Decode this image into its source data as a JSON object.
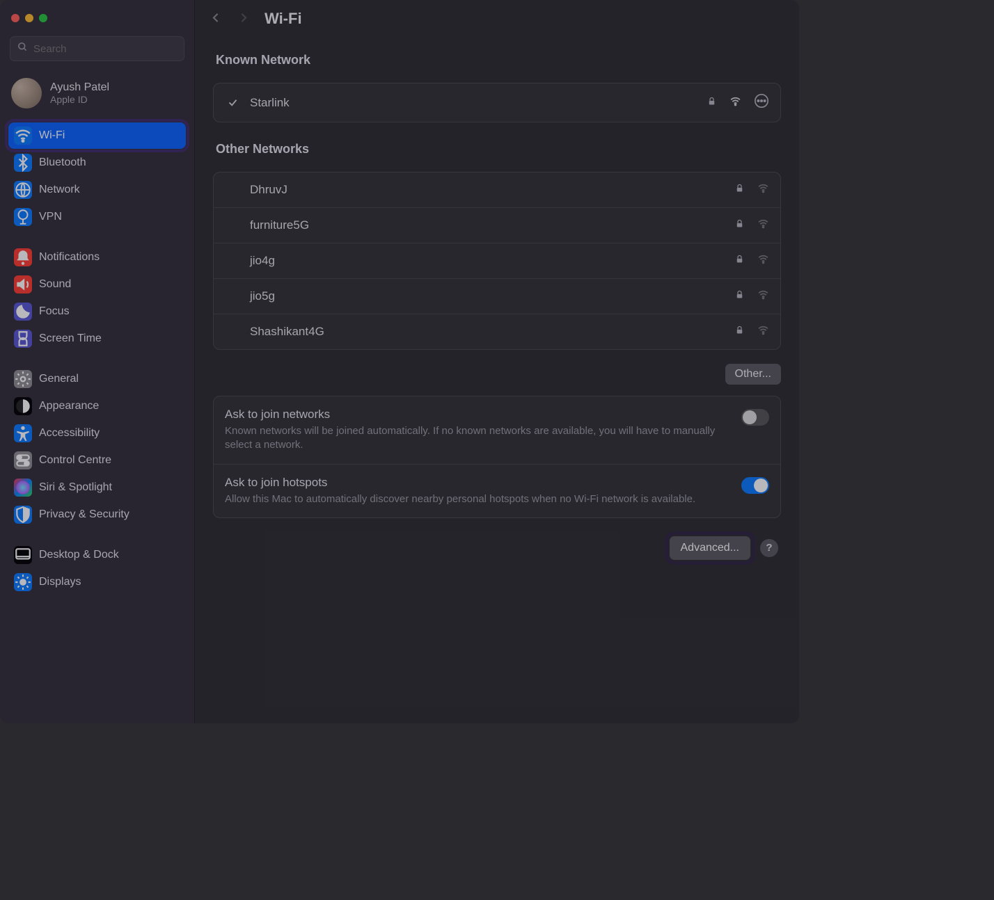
{
  "search": {
    "placeholder": "Search"
  },
  "user": {
    "name": "Ayush Patel",
    "sub": "Apple ID"
  },
  "title": "Wi-Fi",
  "sidebar": {
    "groups": [
      [
        {
          "label": "Wi-Fi",
          "key": "wifi",
          "bg": "bg-blue",
          "selected": true
        },
        {
          "label": "Bluetooth",
          "key": "bluetooth",
          "bg": "bg-blue"
        },
        {
          "label": "Network",
          "key": "network",
          "bg": "bg-blue"
        },
        {
          "label": "VPN",
          "key": "vpn",
          "bg": "bg-blue"
        }
      ],
      [
        {
          "label": "Notifications",
          "key": "notifications",
          "bg": "bg-red"
        },
        {
          "label": "Sound",
          "key": "sound",
          "bg": "bg-red"
        },
        {
          "label": "Focus",
          "key": "focus",
          "bg": "bg-purple"
        },
        {
          "label": "Screen Time",
          "key": "screentime",
          "bg": "bg-purple"
        }
      ],
      [
        {
          "label": "General",
          "key": "general",
          "bg": "bg-grey"
        },
        {
          "label": "Appearance",
          "key": "appearance",
          "bg": ""
        },
        {
          "label": "Accessibility",
          "key": "accessibility",
          "bg": "bg-blue"
        },
        {
          "label": "Control Centre",
          "key": "controlcentre",
          "bg": "bg-grey"
        },
        {
          "label": "Siri & Spotlight",
          "key": "siri",
          "bg": "bg-grad"
        },
        {
          "label": "Privacy & Security",
          "key": "privacy",
          "bg": "bg-blue"
        }
      ],
      [
        {
          "label": "Desktop & Dock",
          "key": "desktop",
          "bg": ""
        },
        {
          "label": "Displays",
          "key": "displays",
          "bg": "bg-blue"
        }
      ]
    ]
  },
  "sections": {
    "known_label": "Known Network",
    "known": [
      {
        "name": "Starlink",
        "connected": true,
        "secured": true
      }
    ],
    "other_label": "Other Networks",
    "other": [
      {
        "name": "DhruvJ",
        "secured": true
      },
      {
        "name": "furniture5G",
        "secured": true
      },
      {
        "name": "jio4g",
        "secured": true
      },
      {
        "name": "jio5g",
        "secured": true
      },
      {
        "name": "Shashikant4G",
        "secured": true
      }
    ],
    "other_button": "Other..."
  },
  "settings": [
    {
      "title": "Ask to join networks",
      "desc": "Known networks will be joined automatically. If no known networks are available, you will have to manually select a network.",
      "on": false
    },
    {
      "title": "Ask to join hotspots",
      "desc": "Allow this Mac to automatically discover nearby personal hotspots when no Wi-Fi network is available.",
      "on": true
    }
  ],
  "footer": {
    "advanced": "Advanced...",
    "help": "?"
  }
}
